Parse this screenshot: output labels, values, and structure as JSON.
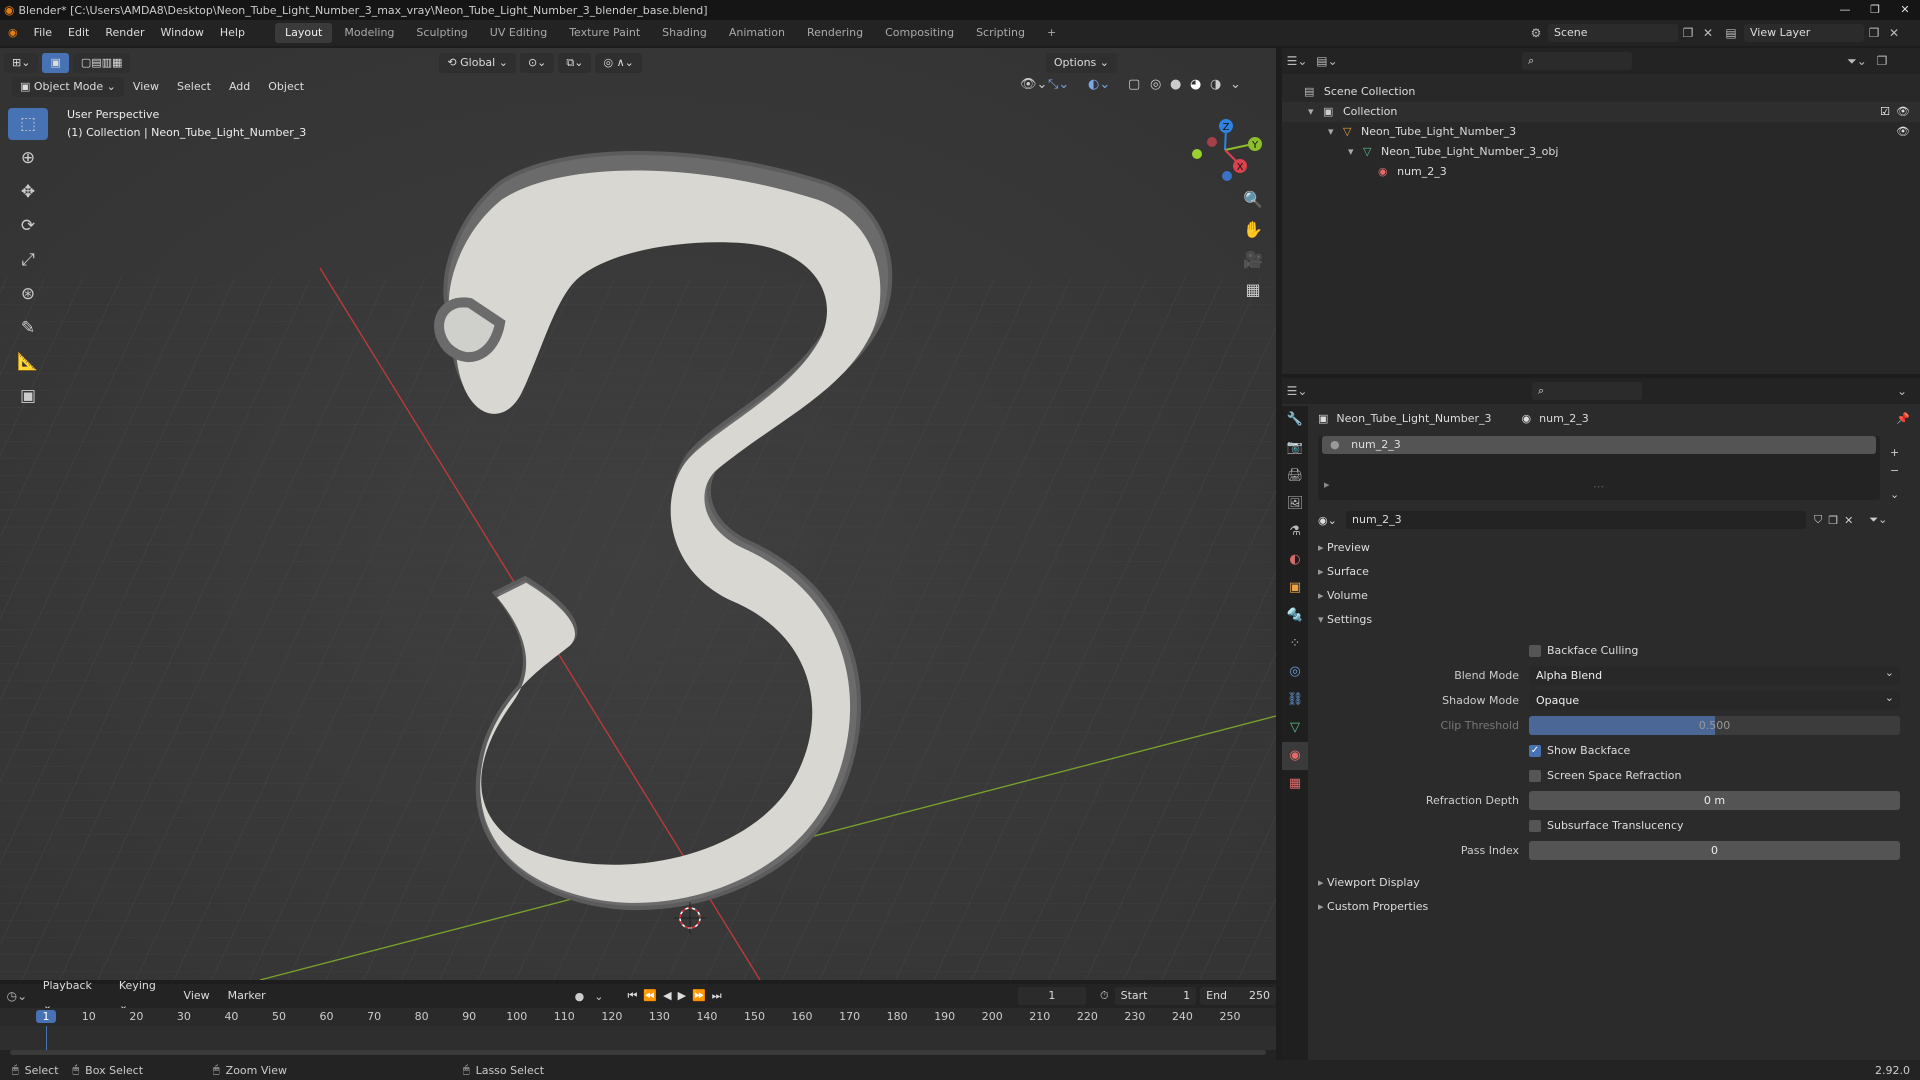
{
  "window": {
    "title": "Blender* [C:\\Users\\AMDA8\\Desktop\\Neon_Tube_Light_Number_3_max_vray\\Neon_Tube_Light_Number_3_blender_base.blend]",
    "controls": [
      "—",
      "❐",
      "✕"
    ]
  },
  "menu": [
    "File",
    "Edit",
    "Render",
    "Window",
    "Help"
  ],
  "workspaces": [
    {
      "label": "Layout",
      "active": true
    },
    {
      "label": "Modeling"
    },
    {
      "label": "Sculpting"
    },
    {
      "label": "UV Editing"
    },
    {
      "label": "Texture Paint"
    },
    {
      "label": "Shading"
    },
    {
      "label": "Animation"
    },
    {
      "label": "Rendering"
    },
    {
      "label": "Compositing"
    },
    {
      "label": "Scripting"
    }
  ],
  "add_workspace": "+",
  "scene": {
    "name": "Scene",
    "view_layer": "View Layer"
  },
  "viewport": {
    "mode": "Object Mode",
    "menus": [
      "View",
      "Select",
      "Add",
      "Object"
    ],
    "orientation": "Global",
    "options": "Options",
    "overlay_title": "User Perspective",
    "overlay_subtitle": "(1) Collection | Neon_Tube_Light_Number_3",
    "gizmo": {
      "x": "X",
      "y": "Y",
      "z": "Z"
    }
  },
  "outliner": {
    "root": "Scene Collection",
    "items": [
      {
        "label": "Collection",
        "depth": 1
      },
      {
        "label": "Neon_Tube_Light_Number_3",
        "depth": 2
      },
      {
        "label": "Neon_Tube_Light_Number_3_obj",
        "depth": 3
      },
      {
        "label": "num_2_3",
        "depth": 4
      }
    ]
  },
  "properties": {
    "breadcrumb_object": "Neon_Tube_Light_Number_3",
    "breadcrumb_material": "num_2_3",
    "slot": "num_2_3",
    "material_name": "num_2_3",
    "panels_top": [
      "Preview",
      "Surface",
      "Volume"
    ],
    "settings_title": "Settings",
    "backface_culling": "Backface Culling",
    "blend_mode_label": "Blend Mode",
    "blend_mode": "Alpha Blend",
    "shadow_mode_label": "Shadow Mode",
    "shadow_mode": "Opaque",
    "clip_threshold_label": "Clip Threshold",
    "clip_threshold": "0.500",
    "clip_threshold_fraction": 0.5,
    "show_backface": "Show Backface",
    "screen_space_refraction": "Screen Space Refraction",
    "refraction_depth_label": "Refraction Depth",
    "refraction_depth": "0 m",
    "subsurface_translucency": "Subsurface Translucency",
    "pass_index_label": "Pass Index",
    "pass_index": "0",
    "panels_bottom": [
      "Viewport Display",
      "Custom Properties"
    ]
  },
  "timeline": {
    "menus": [
      "Playback",
      "Keying",
      "View",
      "Marker"
    ],
    "current_frame": "1",
    "start_label": "Start",
    "start": "1",
    "end_label": "End",
    "end": "250",
    "ticks": [
      "1",
      "10",
      "20",
      "30",
      "40",
      "50",
      "60",
      "70",
      "80",
      "90",
      "100",
      "110",
      "120",
      "130",
      "140",
      "150",
      "160",
      "170",
      "180",
      "190",
      "200",
      "210",
      "220",
      "230",
      "240",
      "250"
    ]
  },
  "statusbar": {
    "select": "Select",
    "box_select": "Box Select",
    "zoom_view": "Zoom View",
    "lasso_select": "Lasso Select",
    "version": "2.92.0"
  },
  "colors": {
    "accent": "#4772b3",
    "x_axis": "#d9424e",
    "y_axis": "#8bbd2c",
    "z_axis": "#2f83e2",
    "blender_orange": "#e87d0d"
  }
}
